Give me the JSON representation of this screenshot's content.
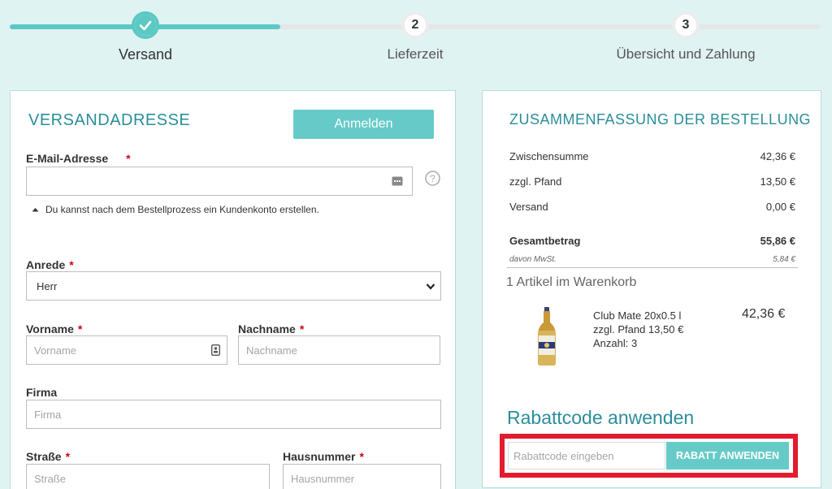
{
  "steps": [
    {
      "number": "1",
      "label": "Versand",
      "state": "done"
    },
    {
      "number": "2",
      "label": "Lieferzeit",
      "state": "pending"
    },
    {
      "number": "3",
      "label": "Übersicht und Zahlung",
      "state": "pending"
    }
  ],
  "shipping": {
    "title": "VERSANDADRESSE",
    "login_button": "Anmelden",
    "email_label": "E-Mail-Adresse",
    "required_mark": "*",
    "email_value": "",
    "account_hint": "Du kannst nach dem Bestellprozess ein Kundenkonto erstellen.",
    "salutation_label": "Anrede",
    "salutation_value": "Herr",
    "firstname_label": "Vorname",
    "firstname_placeholder": "Vorname",
    "lastname_label": "Nachname",
    "lastname_placeholder": "Nachname",
    "company_label": "Firma",
    "company_placeholder": "Firma",
    "street_label": "Straße",
    "street_placeholder": "Straße",
    "housenumber_label": "Hausnummer",
    "housenumber_placeholder": "Hausnummer"
  },
  "summary": {
    "title": "ZUSAMMENFASSUNG DER BESTELLUNG",
    "rows": [
      {
        "label": "Zwischensumme",
        "value": "42,36 €"
      },
      {
        "label": "zzgl. Pfand",
        "value": "13,50 €"
      },
      {
        "label": "Versand",
        "value": "0,00 €"
      }
    ],
    "total_label": "Gesamtbetrag",
    "total_value": "55,86 €",
    "vat_label": "davon MwSt.",
    "vat_value": "5,84 €",
    "cart_count": "1 Artikel im Warenkorb",
    "item": {
      "name": "Club Mate 20x0.5 l",
      "deposit": "zzgl. Pfand 13,50 €",
      "quantity": "Anzahl: 3",
      "price": "42,36 €"
    },
    "coupon_title": "Rabattcode anwenden",
    "coupon_placeholder": "Rabattcode eingeben",
    "coupon_button": "RABATT ANWENDEN"
  },
  "colors": {
    "accent": "#5cc8c4",
    "heading": "#2a8e9a",
    "highlight": "#e21b2e"
  }
}
